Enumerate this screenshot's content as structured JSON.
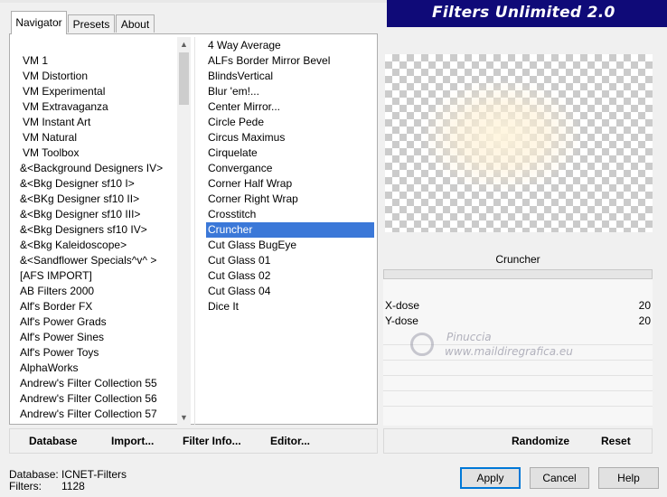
{
  "window": {
    "title": "Filters Unlimited 2.0"
  },
  "tabs": [
    {
      "label": "Navigator",
      "active": true
    },
    {
      "label": "Presets",
      "active": false
    },
    {
      "label": "About",
      "active": false
    }
  ],
  "categories": {
    "items": [
      "VM 1",
      "VM Distortion",
      "VM Experimental",
      "VM Extravaganza",
      "VM Instant Art",
      "VM Natural",
      "VM Toolbox",
      "&<Background Designers IV>",
      "&<Bkg Designer sf10 I>",
      "&<BKg Designer sf10 II>",
      "&<Bkg Designer sf10 III>",
      "&<Bkg Designers sf10 IV>",
      "&<Bkg Kaleidoscope>",
      "&<Sandflower Specials^v^ >",
      "[AFS IMPORT]",
      "AB Filters 2000",
      "Alf's Border FX",
      "Alf's Power Grads",
      "Alf's Power Sines",
      "Alf's Power Toys",
      "AlphaWorks",
      "Andrew's Filter Collection 55",
      "Andrew's Filter Collection 56",
      "Andrew's Filter Collection 57"
    ],
    "scroll_up_icon": "chevron-up-icon",
    "scroll_down_icon": "chevron-down-icon"
  },
  "filters": {
    "items": [
      "4 Way Average",
      "ALFs Border Mirror Bevel",
      "BlindsVertical",
      "Blur 'em!...",
      "Center Mirror...",
      "Circle Pede",
      "Circus Maximus",
      "Cirquelate",
      "Convergance",
      "Corner Half Wrap",
      "Corner Right Wrap",
      "Crosstitch",
      "Cruncher",
      "Cut Glass  BugEye",
      "Cut Glass 01",
      "Cut Glass 02",
      "Cut Glass 04",
      "Dice It"
    ],
    "selected": "Cruncher"
  },
  "preview": {
    "filter_name": "Cruncher",
    "params": [
      {
        "label": "X-dose",
        "value": "20"
      },
      {
        "label": "Y-dose",
        "value": "20"
      }
    ]
  },
  "watermark": {
    "line1": "Pinuccia",
    "line2": "www.maildiregrafica.eu"
  },
  "toolbar": {
    "database": "Database",
    "import": "Import...",
    "filter_info": "Filter Info...",
    "editor": "Editor...",
    "randomize": "Randomize",
    "reset": "Reset"
  },
  "status": {
    "database_label": "Database:",
    "database_value": "ICNET-Filters",
    "filters_label": "Filters:",
    "filters_value": "1128"
  },
  "buttons": {
    "apply": "Apply",
    "cancel": "Cancel",
    "help": "Help"
  },
  "colors": {
    "banner": "#0f0a78",
    "selection": "#3b78d8",
    "default_button_border": "#0078d7"
  }
}
